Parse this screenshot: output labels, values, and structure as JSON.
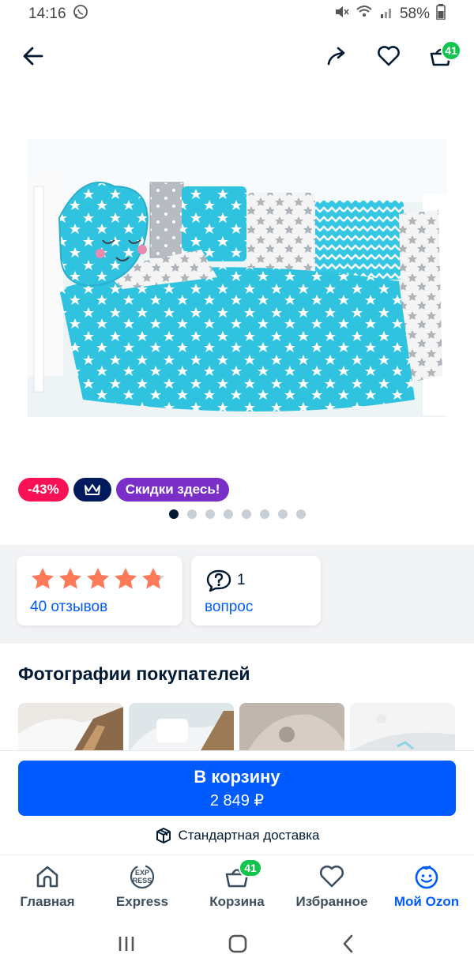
{
  "status_bar": {
    "time": "14:16",
    "battery": "58%"
  },
  "header": {
    "cart_count": "41"
  },
  "badges": {
    "discount": "-43%",
    "sale": "Скидки здесь!"
  },
  "carousel": {
    "count": 8,
    "active": 0
  },
  "reviews": {
    "label": "40 отзывов",
    "rating": 4.8
  },
  "questions": {
    "count": "1",
    "label": "вопрос"
  },
  "customer_photos": {
    "title": "Фотографии покупателей"
  },
  "cart": {
    "button_label": "В корзину",
    "price": "2 849 ₽",
    "delivery": "Стандартная доставка"
  },
  "nav": {
    "items": [
      {
        "label": "Главная",
        "icon": "home-icon"
      },
      {
        "label": "Express",
        "icon": "express-icon",
        "icon_text_top": "EXP",
        "icon_text_bottom": "RESS"
      },
      {
        "label": "Корзина",
        "icon": "basket-icon",
        "badge": "41"
      },
      {
        "label": "Избранное",
        "icon": "heart-icon"
      },
      {
        "label": "Мой Ozon",
        "icon": "profile-icon"
      }
    ]
  },
  "colors": {
    "accent": "#005bff",
    "discount": "#f91155",
    "sale": "#7b2fc9",
    "premium": "#001a5e",
    "badge_green": "#10c44c",
    "star": "#ff7a59"
  }
}
